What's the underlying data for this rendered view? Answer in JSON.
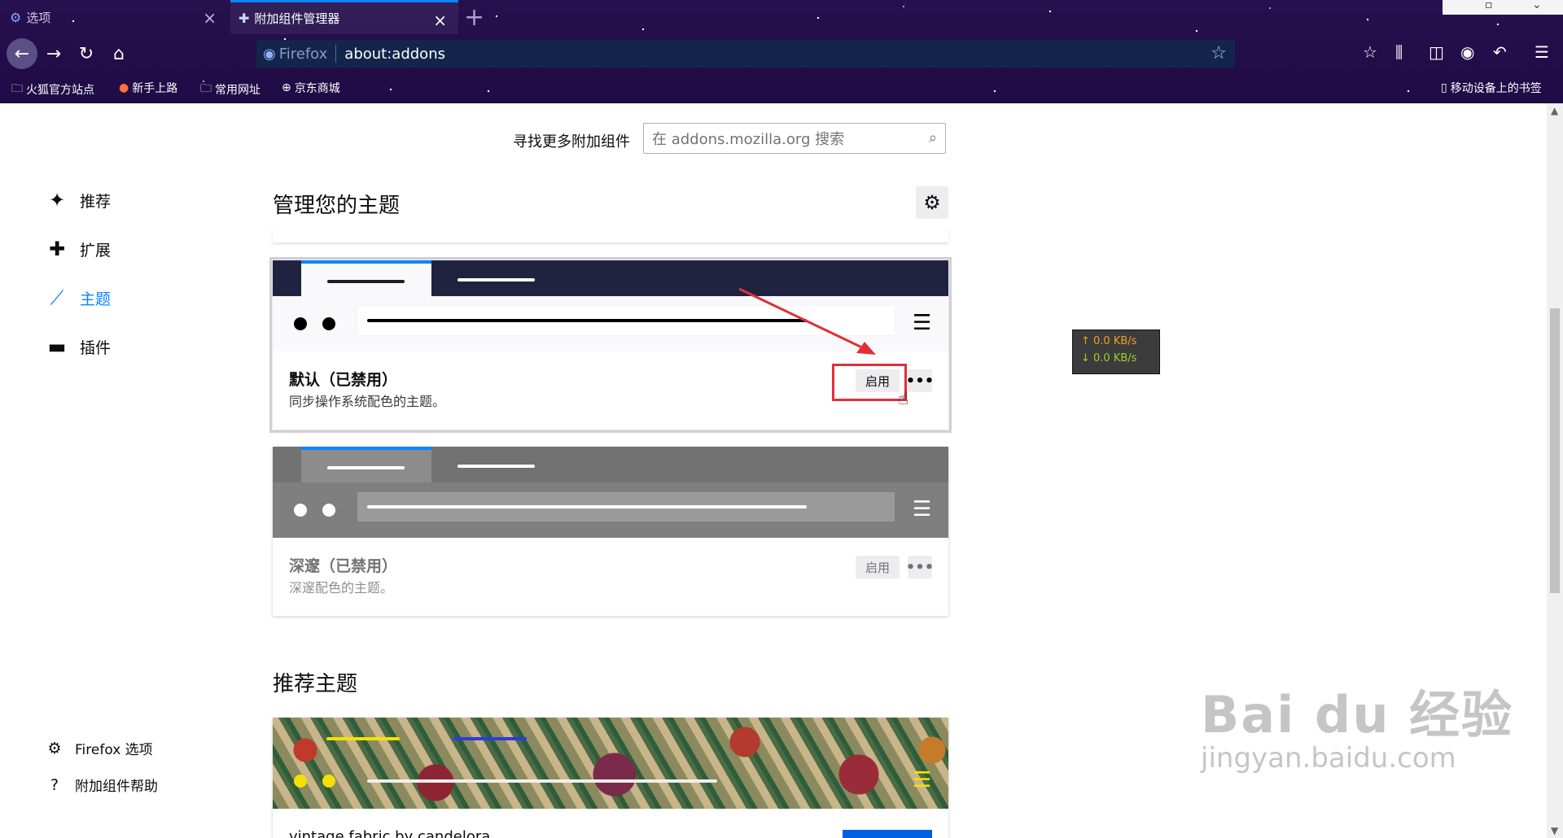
{
  "tabs": [
    {
      "label": "选项",
      "icon": "gear-icon"
    },
    {
      "label": "附加组件管理器",
      "icon": "puzzle-icon"
    }
  ],
  "url_bar": {
    "brand": "Firefox",
    "url": "about:addons"
  },
  "bookmarks": {
    "items": [
      "火狐官方站点",
      "新手上路",
      "常用网址",
      "京东商城"
    ],
    "mobile": "移动设备上的书签"
  },
  "search": {
    "label": "寻找更多附加组件",
    "placeholder": "在 addons.mozilla.org 搜索"
  },
  "categories": [
    {
      "label": "推荐",
      "icon": "sparkle-icon"
    },
    {
      "label": "扩展",
      "icon": "puzzle-icon"
    },
    {
      "label": "主题",
      "icon": "brush-icon",
      "active": true
    },
    {
      "label": "插件",
      "icon": "plugin-icon"
    }
  ],
  "footer": {
    "options": "Firefox 选项",
    "help": "附加组件帮助"
  },
  "manage": {
    "title": "管理您的主题"
  },
  "themes": [
    {
      "name": "默认（已禁用）",
      "description": "同步操作系统配色的主题。",
      "enable_label": "启用",
      "more_label": "•••"
    },
    {
      "name": "深邃（已禁用）",
      "description": "深邃配色的主题。",
      "enable_label": "启用",
      "more_label": "•••"
    }
  ],
  "recommended": {
    "title": "推荐主题",
    "first_name": "vintage fabric by candelora"
  },
  "net_speed": {
    "up": "0.0 KB/s",
    "down": "0.0 KB/s"
  },
  "watermark": {
    "main": "Bai du 经验",
    "sub": "jingyan.baidu.com"
  },
  "colors": {
    "accent": "#0a84ff",
    "highlight": "#e0303a",
    "chrome_bg": "#1c0f3f"
  }
}
